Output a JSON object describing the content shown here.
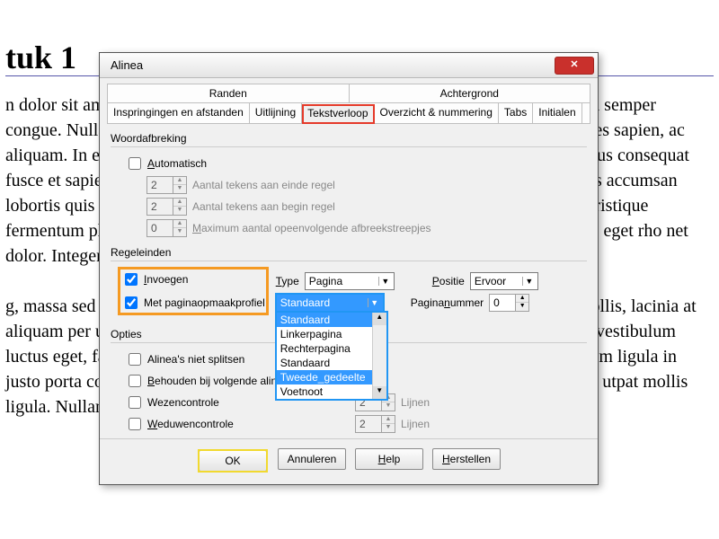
{
  "document": {
    "heading": "tuk 1",
    "body": "n dolor sit amet, consectetur adipiscing elit. Vestibulum consequat mi quis pretium semper congue. Nullam nim. Donec consequat placerat dignissim. Fusce malesuada ultrices sapien, ac aliquam. In eu dia volutpat. Nullam mollis arcu ut lectus condimentum, sed faucibus consequat fusce et sapie. Nulla vitae massa sit amet porttitor et, tempor molestie, varius qu os accumsan lobortis quis convallis. Integer libero ac sollicitudin, libe iquam, nisi id faucibus, tristique fermentum phasellus nibh andit commodo et commodo, vivamus mollis a modales eget rho net dolor. Integer eget venenatis mollis.\n\ng, massa sed congue consequat aliquam, massa sollicitudin nunc era s at massa mollis, lacinia at aliquam per ultrices semper arcu, tincidunt suspendisse posuere nec tincidunt ni e vestibulum luctus eget, faucibus ue pharetra eros, vel malesuada justo commodo at. Cras dictum ligula in justo porta commodo volutpat. Nunc neque arcu, varius ac ultricies et, hendrerit in utpat mollis ligula. Nullam nunc eleifend sodales ullamcorper nec ele"
  },
  "dialog": {
    "title": "Alinea",
    "tabs_top": {
      "a": "Randen",
      "b": "Achtergrond"
    },
    "tabs_bottom": [
      "Inspringingen en afstanden",
      "Uitlijning",
      "Tekstverloop",
      "Overzicht & nummering",
      "Tabs",
      "Initialen"
    ],
    "group_hyphen": {
      "title": "Woordafbreking",
      "auto": "Automatisch",
      "val_end": "2",
      "lbl_end": "Aantal tekens aan einde regel",
      "val_start": "2",
      "lbl_start": "Aantal tekens aan begin regel",
      "val_max": "0",
      "lbl_max": "Maximum aantal opeenvolgende afbreekstreepjes"
    },
    "group_breaks": {
      "title": "Regeleinden",
      "insert": "Invoegen",
      "type_lbl": "Type",
      "type_val": "Pagina",
      "pos_lbl": "Positie",
      "pos_val": "Ervoor",
      "with_style": "Met paginaopmaakprofiel",
      "style_sel": "Standaard",
      "pagenum_lbl": "Paginanummer",
      "pagenum_val": "0",
      "dropdown_options": [
        "Standaard",
        "Linkerpagina",
        "Rechterpagina",
        "Standaard",
        "Tweede_gedeelte",
        "Voetnoot"
      ]
    },
    "group_options": {
      "title": "Opties",
      "nosplit": "Alinea's niet splitsen",
      "keep": "Behouden bij volgende alinea",
      "orphan": "Wezencontrole",
      "widow": "Weduwencontrole",
      "lines_val": "2",
      "lines_lbl": "Lijnen"
    },
    "buttons": {
      "ok": "OK",
      "cancel": "Annuleren",
      "help": "Help",
      "reset": "Herstellen"
    }
  }
}
